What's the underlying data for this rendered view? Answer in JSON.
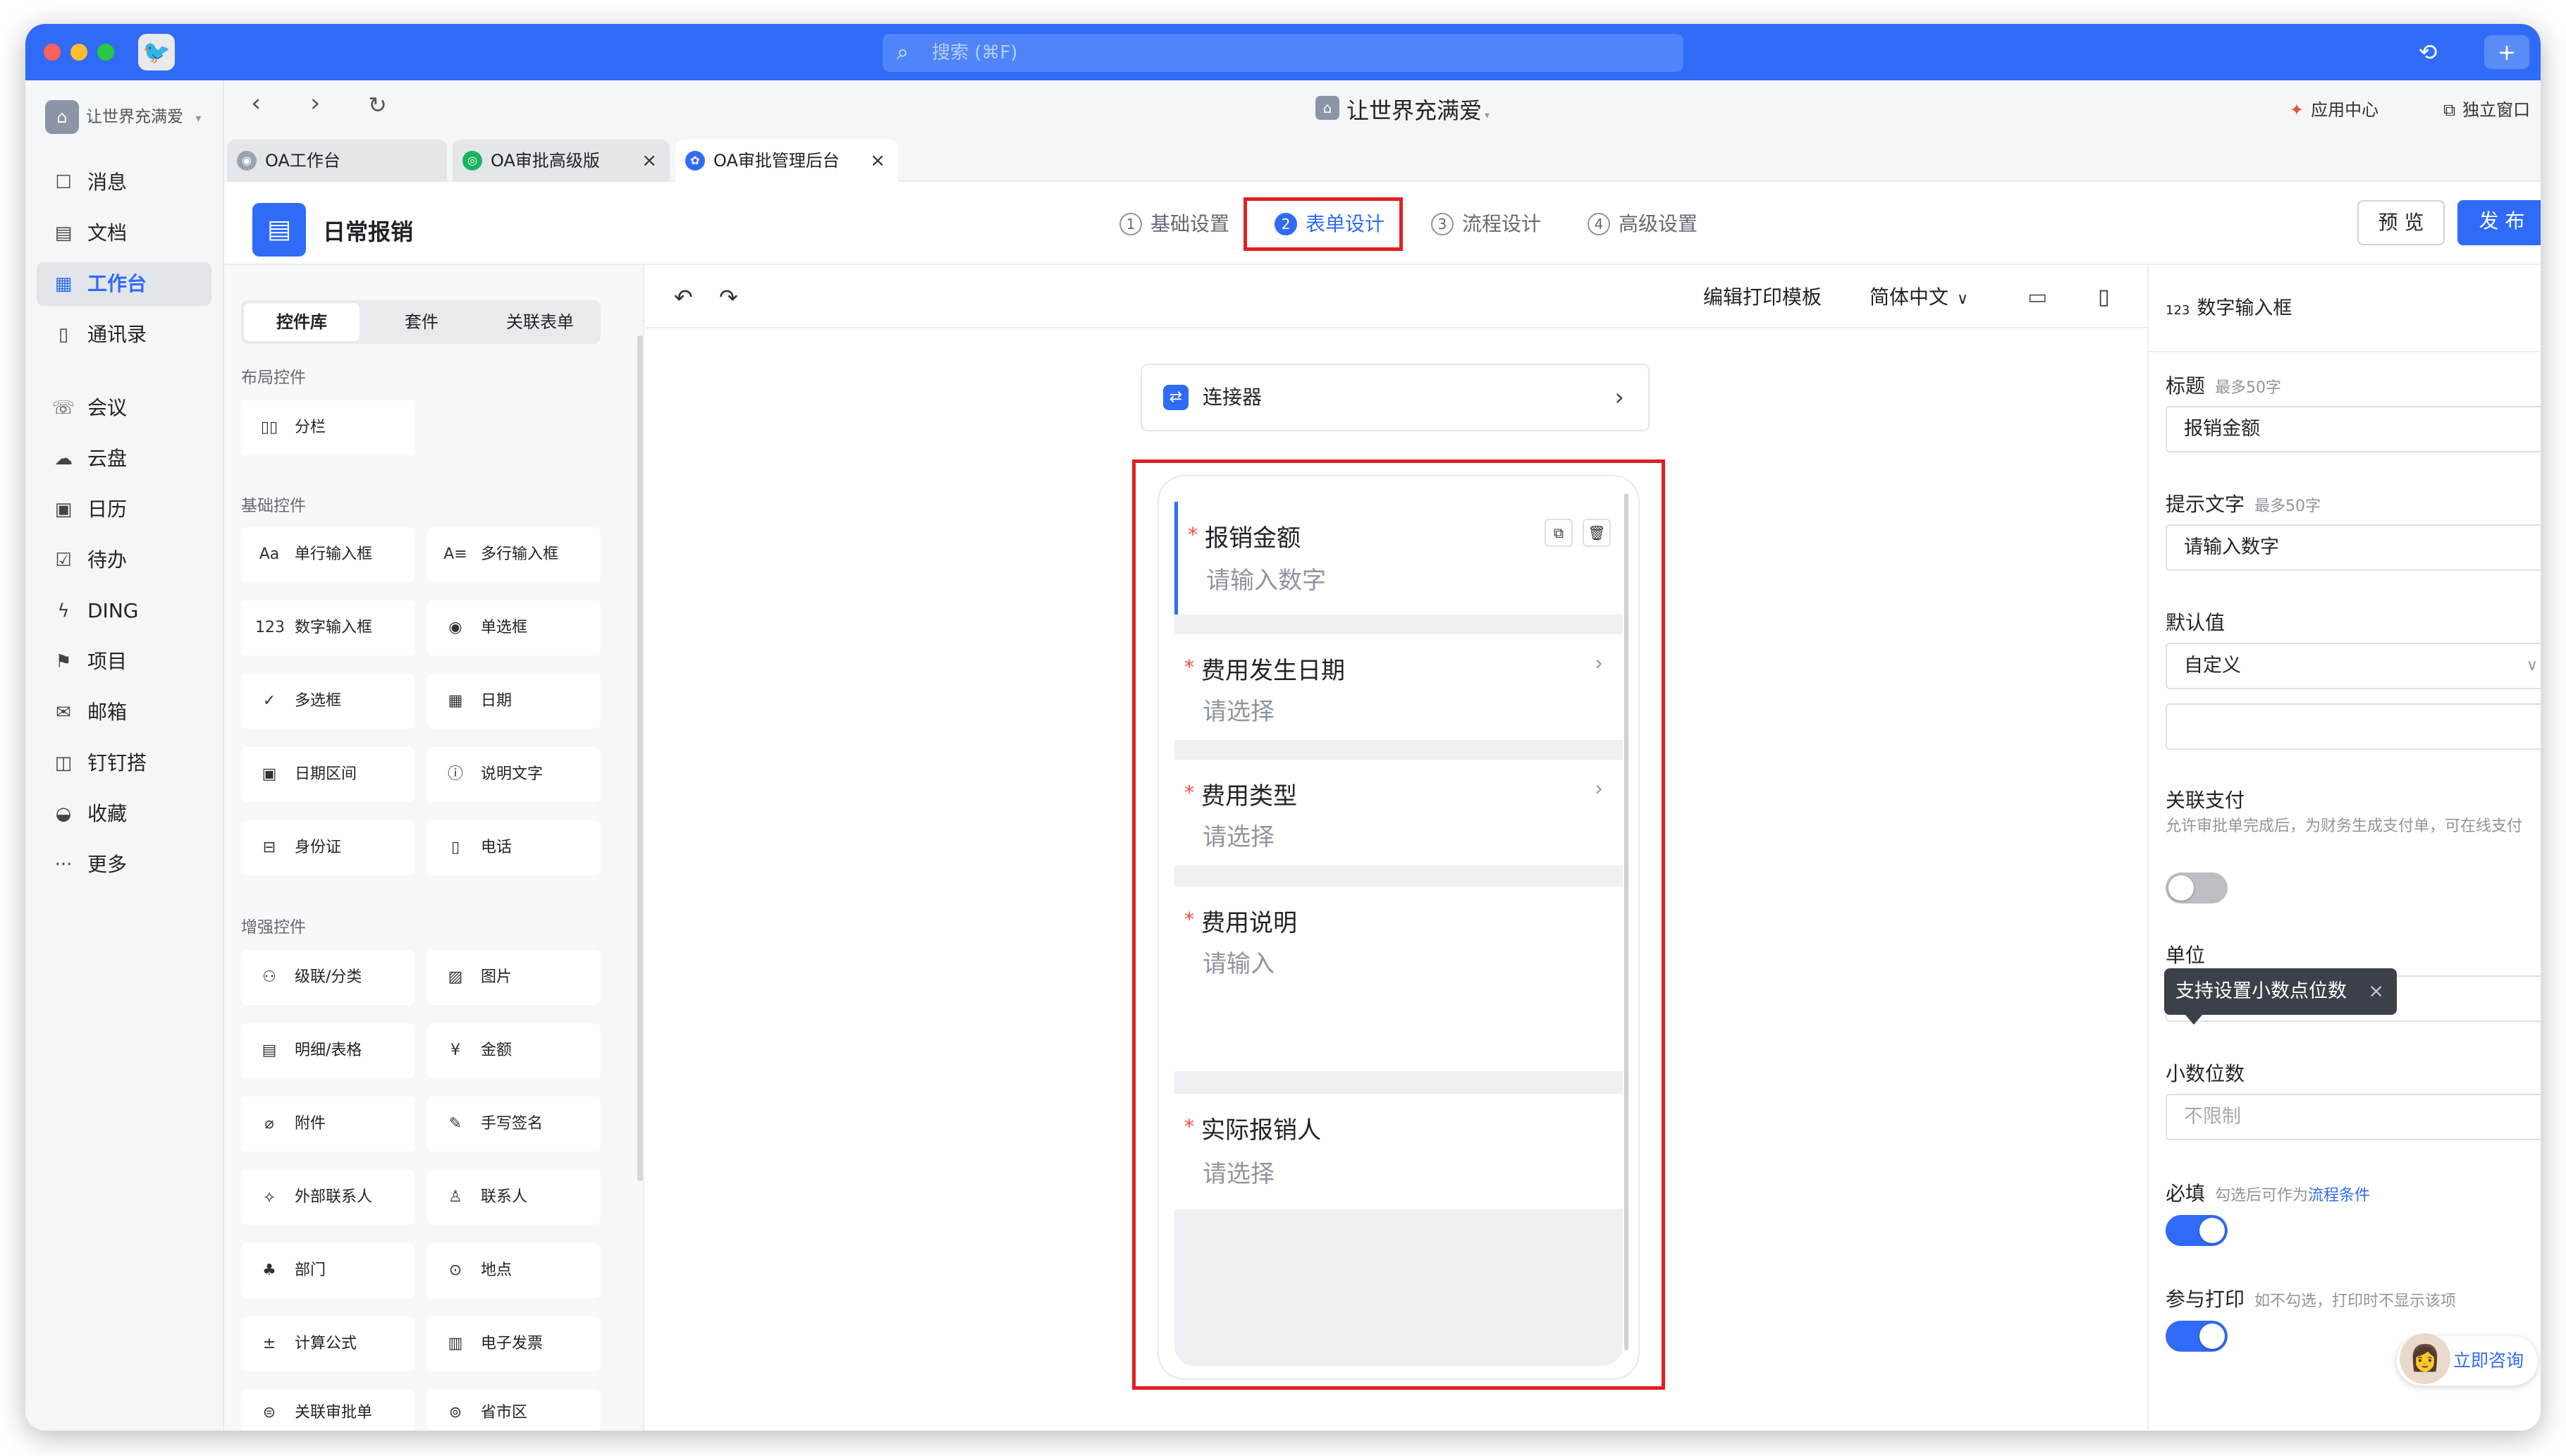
{
  "app": {
    "search_placeholder": "搜索 (⌘F)",
    "window_title": "让世界充满爱",
    "org_name": "让世界充满爱",
    "app_center": "应用中心",
    "standalone_window": "独立窗口"
  },
  "sidebar": {
    "items": [
      {
        "label": "消息",
        "icon": "message-icon"
      },
      {
        "label": "文档",
        "icon": "doc-icon"
      },
      {
        "label": "工作台",
        "icon": "workbench-icon"
      },
      {
        "label": "通讯录",
        "icon": "contacts-icon"
      },
      {
        "label": "会议",
        "icon": "meeting-icon"
      },
      {
        "label": "云盘",
        "icon": "cloud-icon"
      },
      {
        "label": "日历",
        "icon": "calendar-icon"
      },
      {
        "label": "待办",
        "icon": "todo-icon"
      },
      {
        "label": "DING",
        "icon": "ding-icon"
      },
      {
        "label": "项目",
        "icon": "project-icon"
      },
      {
        "label": "邮箱",
        "icon": "mail-icon"
      },
      {
        "label": "钉钉搭",
        "icon": "builder-icon"
      },
      {
        "label": "收藏",
        "icon": "favorite-icon"
      },
      {
        "label": "更多",
        "icon": "more-icon"
      }
    ]
  },
  "tabs": [
    {
      "label": "OA工作台"
    },
    {
      "label": "OA审批高级版"
    },
    {
      "label": "OA审批管理后台"
    }
  ],
  "header": {
    "form_name": "日常报销",
    "steps": [
      {
        "num": "1",
        "label": "基础设置"
      },
      {
        "num": "2",
        "label": "表单设计"
      },
      {
        "num": "3",
        "label": "流程设计"
      },
      {
        "num": "4",
        "label": "高级设置"
      }
    ],
    "preview": "预 览",
    "publish": "发 布"
  },
  "library": {
    "segments": [
      "控件库",
      "套件",
      "关联表单"
    ],
    "sections": [
      {
        "title": "布局控件",
        "items": [
          {
            "label": "分栏",
            "icon": "columns-icon"
          }
        ]
      },
      {
        "title": "基础控件",
        "items": [
          {
            "label": "单行输入框",
            "icon": "text-input-icon"
          },
          {
            "label": "多行输入框",
            "icon": "textarea-icon"
          },
          {
            "label": "数字输入框",
            "icon": "number-input-icon"
          },
          {
            "label": "单选框",
            "icon": "radio-icon"
          },
          {
            "label": "多选框",
            "icon": "checkbox-icon"
          },
          {
            "label": "日期",
            "icon": "date-icon"
          },
          {
            "label": "日期区间",
            "icon": "date-range-icon"
          },
          {
            "label": "说明文字",
            "icon": "info-icon"
          },
          {
            "label": "身份证",
            "icon": "id-card-icon"
          },
          {
            "label": "电话",
            "icon": "phone-icon"
          }
        ]
      },
      {
        "title": "增强控件",
        "items": [
          {
            "label": "级联/分类",
            "icon": "cascade-icon"
          },
          {
            "label": "图片",
            "icon": "image-icon"
          },
          {
            "label": "明细/表格",
            "icon": "table-icon"
          },
          {
            "label": "金额",
            "icon": "money-icon"
          },
          {
            "label": "附件",
            "icon": "attachment-icon"
          },
          {
            "label": "手写签名",
            "icon": "signature-icon"
          },
          {
            "label": "外部联系人",
            "icon": "external-contact-icon"
          },
          {
            "label": "联系人",
            "icon": "contact-icon"
          },
          {
            "label": "部门",
            "icon": "department-icon"
          },
          {
            "label": "地点",
            "icon": "location-icon"
          },
          {
            "label": "计算公式",
            "icon": "formula-icon"
          },
          {
            "label": "电子发票",
            "icon": "invoice-icon"
          },
          {
            "label": "关联审批单",
            "icon": "link-approval-icon"
          },
          {
            "label": "省市区",
            "icon": "region-icon"
          }
        ]
      }
    ]
  },
  "canvas": {
    "edit_print": "编辑打印模板",
    "language": "简体中文",
    "connector": "连接器",
    "fields": [
      {
        "label": "报销金额",
        "placeholder": "请输入数字"
      },
      {
        "label": "费用发生日期",
        "placeholder": "请选择"
      },
      {
        "label": "费用类型",
        "placeholder": "请选择"
      },
      {
        "label": "费用说明",
        "placeholder": "请输入"
      },
      {
        "label": "实际报销人",
        "placeholder": "请选择"
      }
    ]
  },
  "props": {
    "control_type": "数字输入框",
    "control_type_icon": "123",
    "title_label": "标题",
    "title_hint": "最多50字",
    "title_value": "报销金额",
    "placeholder_label": "提示文字",
    "placeholder_hint": "最多50字",
    "placeholder_value": "请输入数字",
    "default_label": "默认值",
    "default_value": "自定义",
    "pay_label": "关联支付",
    "pay_desc": "允许审批单完成后，为财务生成支付单，可在线支付",
    "unit_label": "单位",
    "tooltip": "支持设置小数点位数",
    "decimal_label": "小数位数",
    "decimal_placeholder": "不限制",
    "required_label": "必填",
    "required_hint_prefix": "勾选后可作为",
    "required_hint_link": "流程条件",
    "print_label": "参与打印",
    "print_hint": "如不勾选，打印时不显示该项",
    "consult": "立即咨询"
  },
  "colors": {
    "accent": "#2f6bf6",
    "highlight": "#e02020",
    "required": "#f54a45"
  }
}
